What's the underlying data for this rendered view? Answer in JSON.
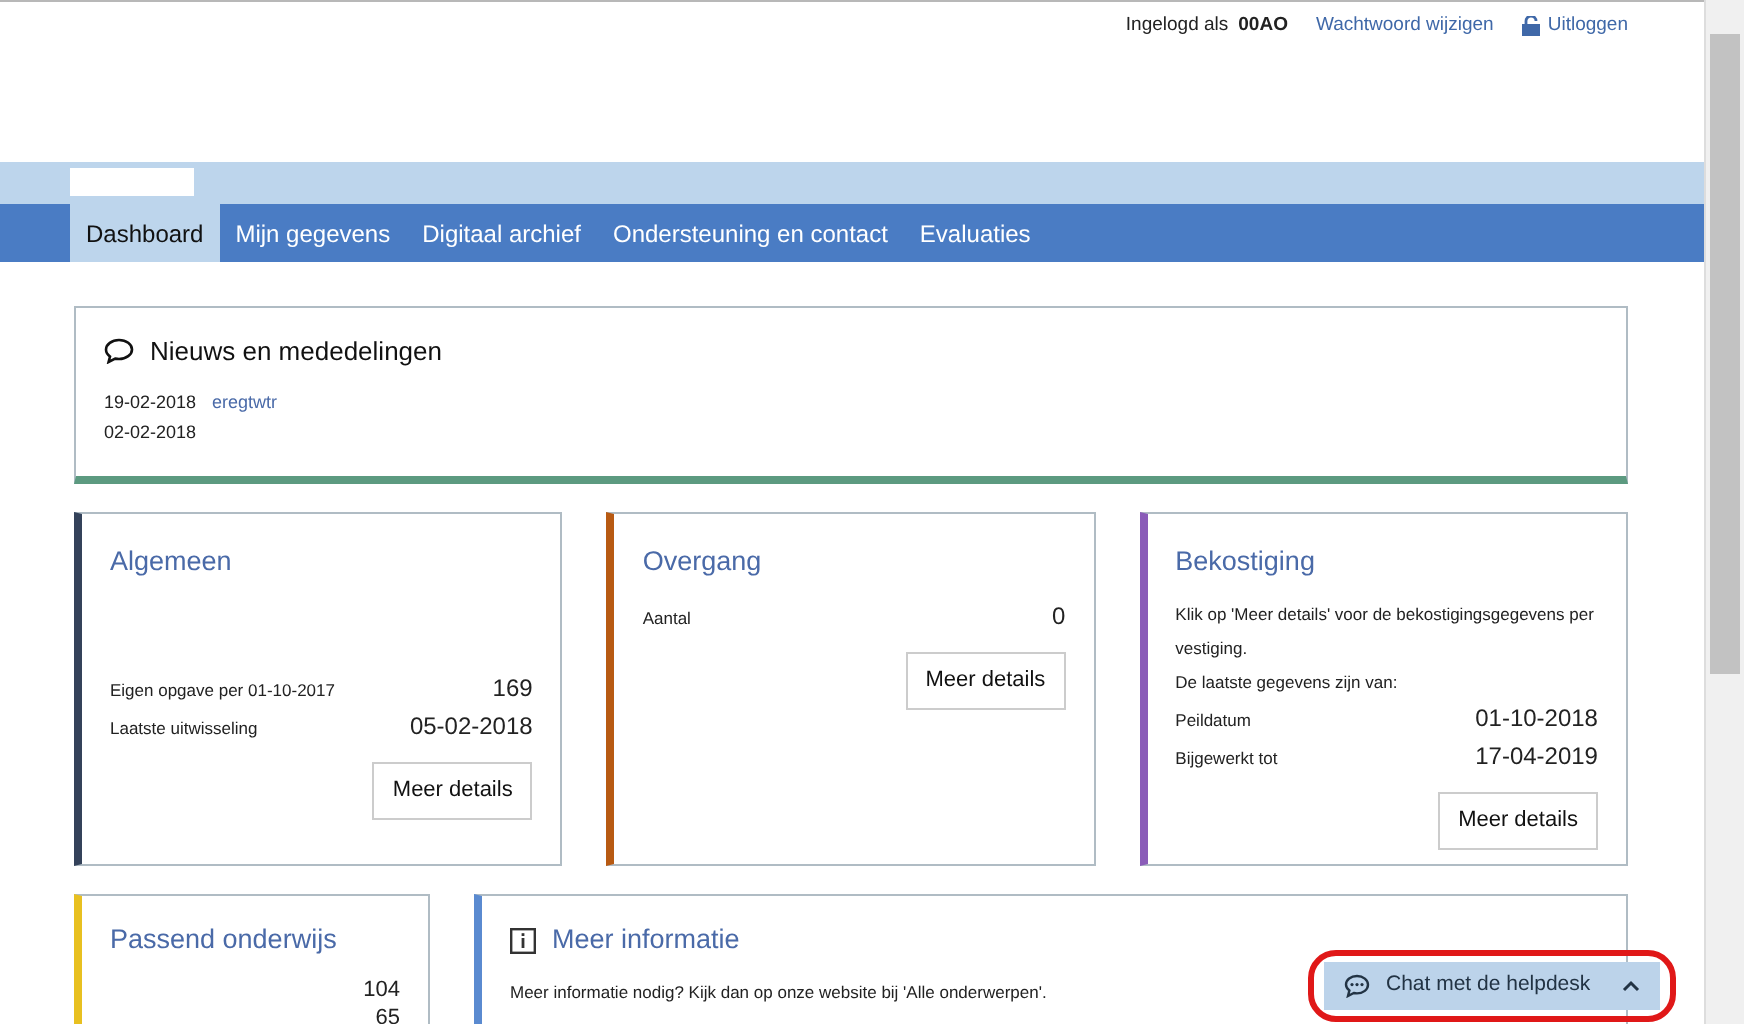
{
  "header": {
    "login_label": "Ingelogd als",
    "user": "00AO",
    "links": [
      {
        "label": "Wachtwoord wijzigen",
        "kind": "text"
      },
      {
        "label": "Uitloggen",
        "kind": "lock"
      }
    ]
  },
  "nav": {
    "tabs": [
      {
        "label": "Dashboard",
        "selected": true
      },
      {
        "label": "Mijn gegevens",
        "selected": false
      },
      {
        "label": "Digitaal archief",
        "selected": false
      },
      {
        "label": "Ondersteuning en contact",
        "selected": false
      },
      {
        "label": "Evaluaties",
        "selected": false
      }
    ]
  },
  "news": {
    "title": "Nieuws en mededelingen",
    "color": "#5c9a80",
    "items": [
      {
        "date": "19-02-2018",
        "text": "eregtwtr"
      },
      {
        "date": "02-02-2018"
      }
    ]
  },
  "cards": [
    {
      "title": "Algemeen",
      "color": "#34425a",
      "kind": "summary",
      "rows": [
        {
          "label": "Eigen opgave per 01-10-2017",
          "value": "169"
        },
        {
          "label": "Laatste uitwisseling",
          "value": "05-02-2018"
        }
      ],
      "button": "Meer details"
    },
    {
      "title": "Overgang",
      "color": "#b85a12",
      "kind": "stats",
      "rows": [
        {
          "label": "Aantal",
          "value": "0"
        }
      ],
      "button": "Meer details"
    },
    {
      "title": "Bekostiging",
      "color": "#8a5cb8",
      "kind": "stats",
      "intro": [
        "Klik op 'Meer details' voor de bekostigingsgegevens per vestiging.",
        "De laatste gegevens zijn van:"
      ],
      "rows": [
        {
          "label": "Peildatum",
          "value": "01-10-2018"
        },
        {
          "label": "Bijgewerkt tot",
          "value": "17-04-2019"
        }
      ],
      "button": "Meer details"
    }
  ],
  "bottom_cards": [
    {
      "title": "Passend onderwijs",
      "color": "#e8c020",
      "kind": "values",
      "values": [
        "104",
        "65"
      ]
    },
    {
      "title": "Meer informatie",
      "color": "#5a8ad0",
      "kind": "info",
      "text": "Meer informatie nodig? Kijk dan op onze website bij 'Alle onderwerpen'."
    }
  ],
  "chat": {
    "label": "Chat met de helpdesk",
    "highlighted": true
  }
}
